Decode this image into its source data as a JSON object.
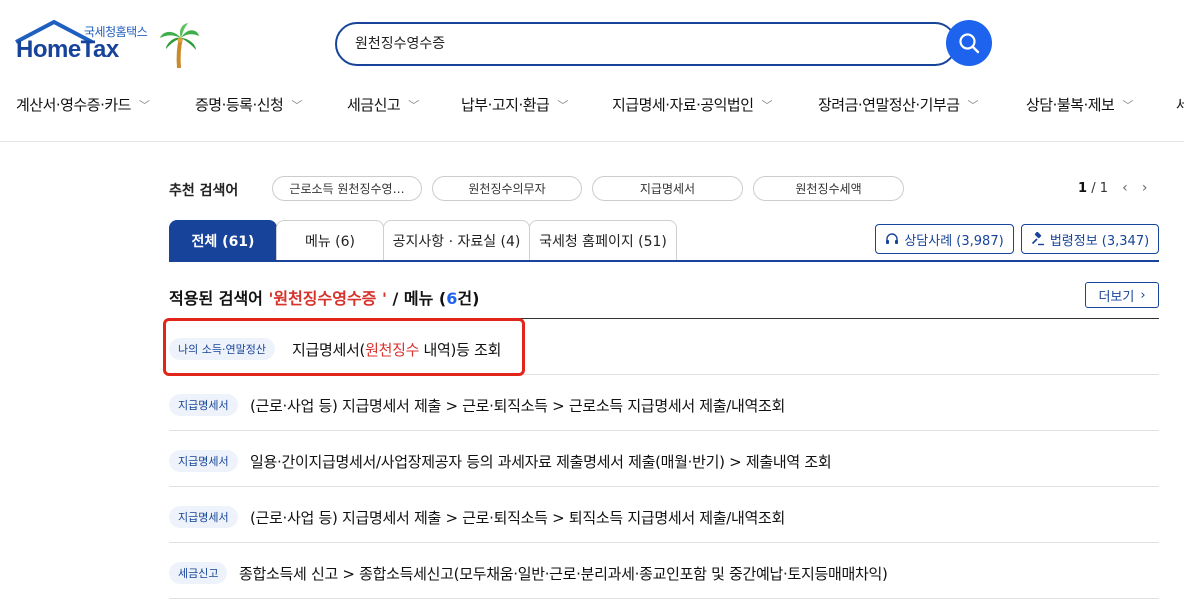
{
  "header": {
    "logo_sub": "국세청홈택스",
    "logo_main": "HomeTax",
    "search_value": "원천징수영수증"
  },
  "nav": {
    "items": [
      {
        "label": "계산서·영수증·카드"
      },
      {
        "label": "증명·등록·신청"
      },
      {
        "label": "세금신고"
      },
      {
        "label": "납부·고지·환급"
      },
      {
        "label": "지급명세·자료·공익법인"
      },
      {
        "label": "장려금·연말정산·기부금"
      },
      {
        "label": "상담·불복·제보"
      },
      {
        "label": "세"
      }
    ]
  },
  "recommend": {
    "label": "추천 검색어",
    "chips": [
      "근로소득 원천징수영…",
      "원천징수의무자",
      "지급명세서",
      "원천징수세액"
    ],
    "page_current": "1",
    "page_total": "/ 1"
  },
  "tabs": [
    {
      "label": "전체 (61)",
      "active": true
    },
    {
      "label": "메뉴 (6)"
    },
    {
      "label": "공지사항 · 자료실 (4)"
    },
    {
      "label": "국세청 홈페이지 (51)"
    }
  ],
  "side_buttons": {
    "consult": "상담사례 (3,987)",
    "law": "법령정보 (3,347)"
  },
  "applied": {
    "prefix": "적용된 검색어 ",
    "keyword": "'원천징수영수증 '",
    "middle": " / 메뉴 (",
    "count": "6",
    "suffix": "건)",
    "more": "더보기"
  },
  "results": [
    {
      "badge": "나의 소득·연말정산",
      "title_pre": "지급명세서(",
      "title_hl": "원천징수",
      "title_post": " 내역)등 조회"
    },
    {
      "badge": "지급명세서",
      "title_pre": "(근로·사업 등) 지급명세서 제출 > 근로·퇴직소득 > 근로소득 지급명세서 제출/내역조회",
      "title_hl": "",
      "title_post": ""
    },
    {
      "badge": "지급명세서",
      "title_pre": "일용·간이지급명세서/사업장제공자 등의 과세자료 제출명세서 제출(매월·반기) > 제출내역 조회",
      "title_hl": "",
      "title_post": ""
    },
    {
      "badge": "지급명세서",
      "title_pre": "(근로·사업 등) 지급명세서 제출 > 근로·퇴직소득 > 퇴직소득 지급명세서 제출/내역조회",
      "title_hl": "",
      "title_post": ""
    },
    {
      "badge": "세금신고",
      "title_pre": "종합소득세 신고 > 종합소득세신고(모두채움·일반·근로·분리과세·종교인포함 및 중간예납·토지등매매차익)",
      "title_hl": "",
      "title_post": ""
    }
  ]
}
